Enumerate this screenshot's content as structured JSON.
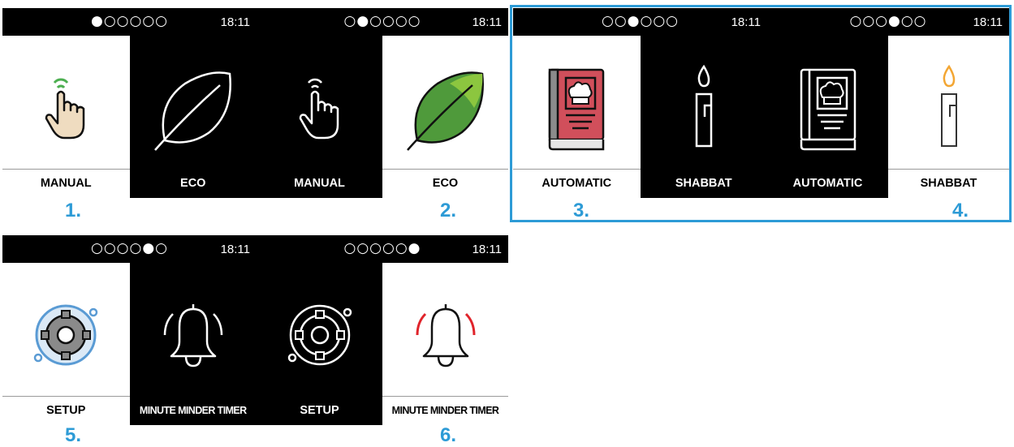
{
  "colors": {
    "accent": "#2d9bd6",
    "book_red": "#d14f5b",
    "leaf_green": "#4f9a3b",
    "bell_red": "#e0242b",
    "flame_orange": "#f3a633"
  },
  "panels": [
    {
      "dots": "●○○○○○",
      "time": "18:11",
      "left": {
        "label": "MANUAL",
        "icon": "hand-pointer-icon"
      },
      "right": {
        "label": "ECO",
        "icon": "leaf-icon"
      }
    },
    {
      "dots": "○●○○○○",
      "time": "18:11",
      "left": {
        "label": "MANUAL",
        "icon": "hand-pointer-icon"
      },
      "right": {
        "label": "ECO",
        "icon": "leaf-icon"
      }
    },
    {
      "dots": "○○●○○○",
      "time": "18:11",
      "left": {
        "label": "AUTOMATIC",
        "icon": "recipe-book-icon"
      },
      "right": {
        "label": "SHABBAT",
        "icon": "candle-icon"
      }
    },
    {
      "dots": "○○○●○○",
      "time": "18:11",
      "left": {
        "label": "AUTOMATIC",
        "icon": "recipe-book-icon"
      },
      "right": {
        "label": "SHABBAT",
        "icon": "candle-icon"
      }
    },
    {
      "dots": "○○○○●○",
      "time": "18:11",
      "left": {
        "label": "SETUP",
        "icon": "gear-icon"
      },
      "right": {
        "label": "MINUTE MINDER TIMER",
        "icon": "bell-icon"
      }
    },
    {
      "dots": "○○○○○●",
      "time": "18:11",
      "left": {
        "label": "SETUP",
        "icon": "gear-icon"
      },
      "right": {
        "label": "MINUTE MINDER TIMER",
        "icon": "bell-icon"
      }
    }
  ],
  "step_numbers": [
    "1.",
    "2.",
    "3.",
    "4.",
    "5.",
    "6."
  ]
}
